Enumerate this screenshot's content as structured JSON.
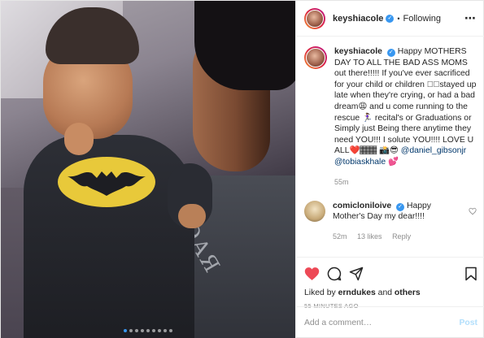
{
  "post": {
    "username": "keyshiacole",
    "follow_status": "Following",
    "more_icon": "⋯"
  },
  "photo": {
    "shirt_text": "ЯЭАЯ",
    "carousel_dots": 9,
    "active_dot": 0
  },
  "caption": {
    "username": "keyshiacole",
    "text": "Happy MOTHERS DAY TO ALL THE BAD ASS MOMS out there!!!!! If you've ever sacrificed for your child or children 🏾🏾stayed up late when they're crying, or had a bad dream😩 and u come running to the rescue 🏃🏽‍♀️ recital's or Graduations or Simply just Being there anytime they need YOU!!! I solute YOU!!!! LOVE U ALL❤️🏾🏾  📸😎",
    "mentions": "@daniel_gibsonjr @tobiaskhale",
    "mention_emoji": "💕",
    "age": "55m"
  },
  "comment": {
    "username": "comicloniloive",
    "text": "Happy Mother's Day my dear!!!!",
    "age": "52m",
    "likes": "13 likes",
    "reply": "Reply"
  },
  "actions": {
    "liked_prefix": "Liked by ",
    "liked_user": "erndukes",
    "liked_and": " and ",
    "liked_others": "others",
    "timestamp": "55 MINUTES AGO"
  },
  "composer": {
    "placeholder": "Add a comment…",
    "post_label": "Post"
  },
  "colors": {
    "like_red": "#ed4956",
    "verified_blue": "#3897f0",
    "post_button": "#b2dffc"
  }
}
